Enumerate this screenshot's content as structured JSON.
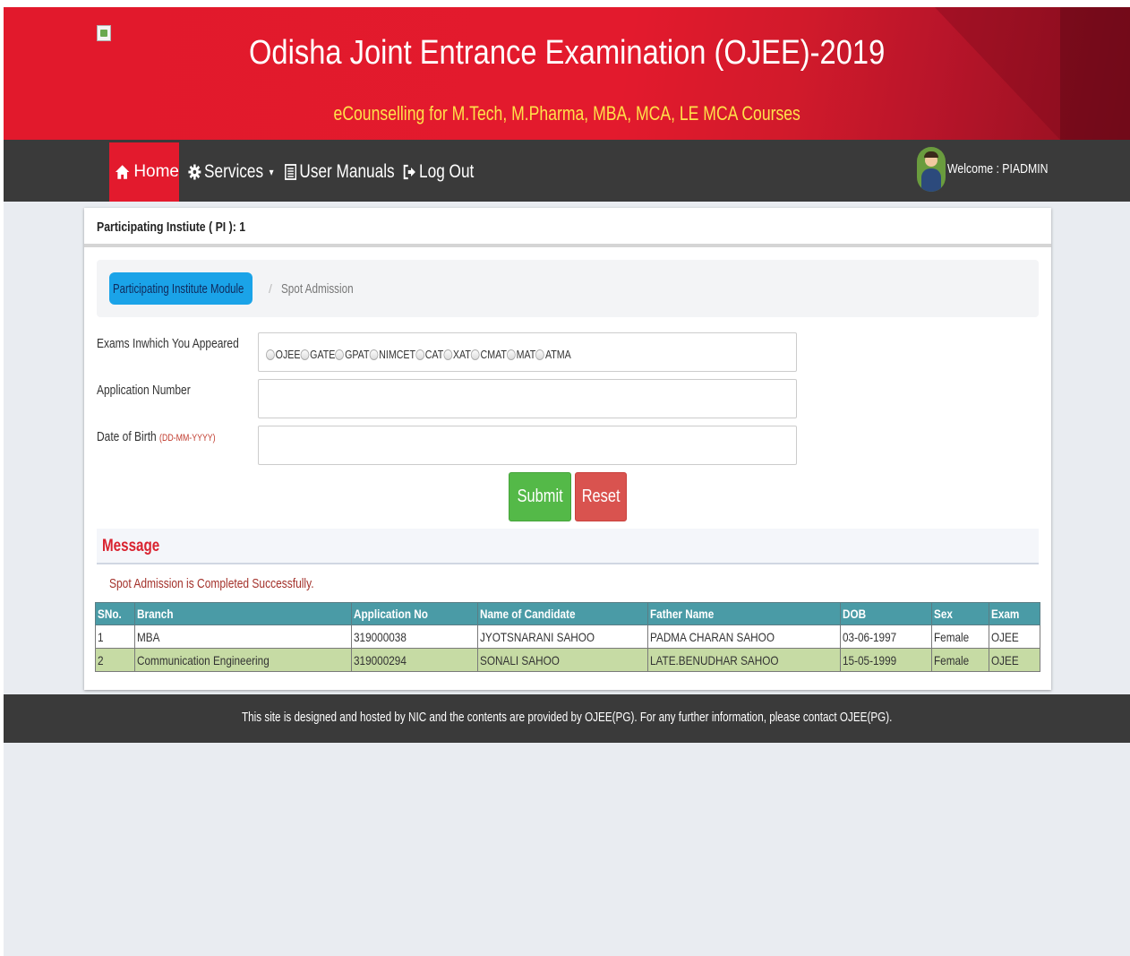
{
  "header": {
    "title": "Odisha Joint Entrance Examination (OJEE)-2019",
    "subtitle": "eCounselling for M.Tech, M.Pharma, MBA, MCA, LE MCA Courses"
  },
  "nav": {
    "home": "Home",
    "services": "Services",
    "user_manuals": "User Manuals",
    "logout": "Log Out",
    "welcome": "Welcome : PIADMIN"
  },
  "panel": {
    "heading": "Participating Instiute ( PI ): 1"
  },
  "breadcrumb": {
    "active": "Participating Institute Module",
    "separator": "/",
    "current": "Spot Admission"
  },
  "form": {
    "exams_label": "Exams Inwhich You Appeared",
    "exam_options": [
      "OJEE",
      "GATE",
      "GPAT",
      "NIMCET",
      "CAT",
      "XAT",
      "CMAT",
      "MAT",
      "ATMA"
    ],
    "application_label": "Application Number",
    "application_value": "",
    "dob_label": "Date of Birth",
    "dob_hint": "(DD-MM-YYYY)",
    "dob_value": "",
    "submit_label": "Submit",
    "reset_label": "Reset"
  },
  "message": {
    "heading": "Message",
    "text": "Spot Admission is Completed Successfully."
  },
  "table": {
    "columns": [
      "SNo.",
      "Branch",
      "Application No",
      "Name of Candidate",
      "Father Name",
      "DOB",
      "Sex",
      "Exam"
    ],
    "rows": [
      [
        "1",
        "MBA",
        "319000038",
        "JYOTSNARANI SAHOO",
        "PADMA CHARAN SAHOO",
        "03-06-1997",
        "Female",
        "OJEE"
      ],
      [
        "2",
        "Communication Engineering",
        "319000294",
        "SONALI SAHOO",
        "LATE.BENUDHAR SAHOO",
        "15-05-1999",
        "Female",
        "OJEE"
      ]
    ]
  },
  "footer": {
    "text": "This site is designed and hosted by NIC and the contents are provided by OJEE(PG). For any further information, please contact OJEE(PG)."
  },
  "colors": {
    "header_red": "#e31a2d",
    "subtitle_yellow": "#ffe14a",
    "nav_dark": "#3a3a3a",
    "table_header": "#4a9ba6",
    "row_alt": "#c6dba4",
    "submit_green": "#54b948",
    "reset_red": "#d9534f",
    "breadcrumb_blue": "#1aa3e8"
  },
  "icons": {
    "home": "home-icon",
    "services": "gear-icon",
    "user_manuals": "document-icon",
    "logout": "logout-icon",
    "logo": "broken-image-icon",
    "avatar": "user-avatar"
  }
}
